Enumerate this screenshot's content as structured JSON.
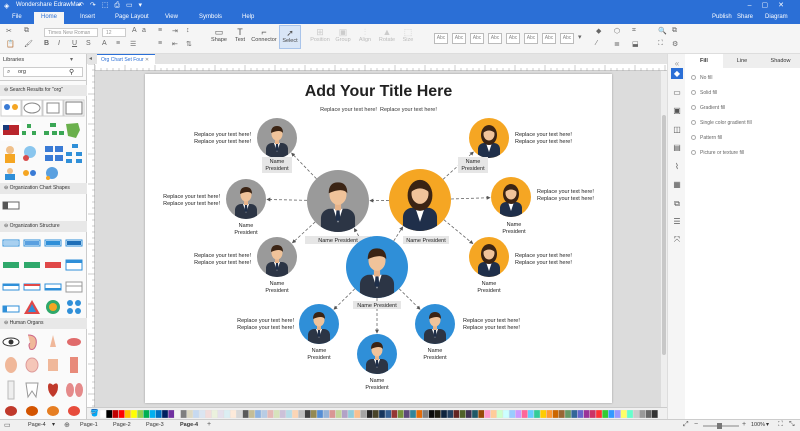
{
  "app": {
    "title": "Wondershare EdrawMax"
  },
  "menu": {
    "items": [
      "File",
      "Home",
      "Insert",
      "Page Layout",
      "View",
      "Symbols",
      "Help"
    ],
    "active": "Home",
    "right": [
      "Publish",
      "Share",
      "Diagram"
    ]
  },
  "ribbon": {
    "font_name": "Times New Roman",
    "font_size": "12",
    "tools": [
      "Shape",
      "Text",
      "Connector",
      "Select"
    ],
    "disabled_tools": [
      "Position",
      "Group",
      "Align",
      "Rotate",
      "Size"
    ],
    "style_sample": "Abc"
  },
  "library": {
    "header": "Libraries",
    "search_value": "org",
    "sections": [
      "Search Results for \"org\"",
      "Organization Chart Shapes",
      "Organization Structure",
      "Human Organs"
    ]
  },
  "document": {
    "tab": "Org Chart Set Four"
  },
  "diagram": {
    "title": "Add Your Title Here",
    "subtitle": "Replace your text here!  Replace your text here!",
    "node_label": "Name President",
    "name_line": "Name",
    "role_line": "President",
    "callout_line": "Replace your text here!",
    "colors": {
      "gray": "#9a9a9a",
      "orange": "#f5a623",
      "blue": "#2f8fd8",
      "label_bg": "#e6e6e6"
    }
  },
  "pages": {
    "selector": "Page-4",
    "tabs": [
      "Page-1",
      "Page-2",
      "Page-3",
      "Page-4"
    ],
    "active": "Page-4"
  },
  "status": {
    "zoom": "100%"
  },
  "fill_panel": {
    "tabs": [
      "Fill",
      "Line",
      "Shadow"
    ],
    "active": "Fill",
    "options": [
      "No fill",
      "Solid fill",
      "Gradient fill",
      "Single color gradient fill",
      "Pattern fill",
      "Picture or texture fill"
    ]
  }
}
